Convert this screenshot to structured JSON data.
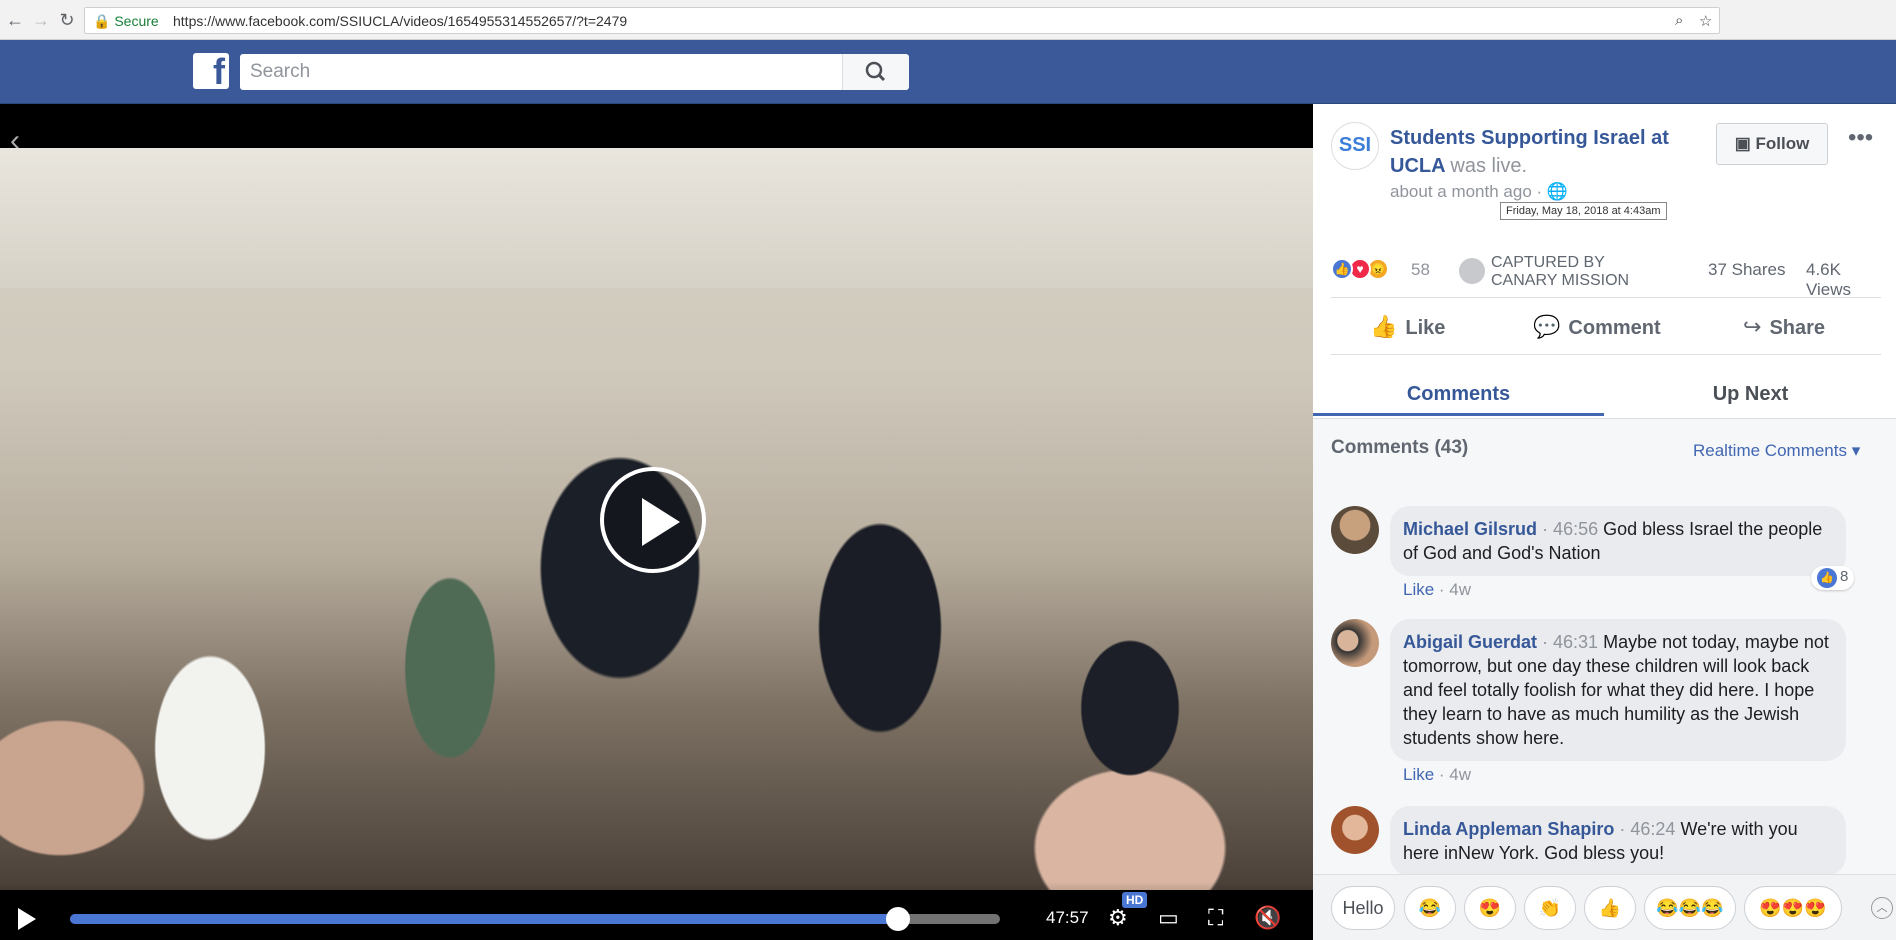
{
  "browser": {
    "secure_label": "Secure",
    "url": "https://www.facebook.com/SSIUCLA/videos/1654955314552657/?t=2479"
  },
  "header": {
    "logo": "f",
    "search_placeholder": "Search"
  },
  "video": {
    "time": "47:57",
    "hd_label": "HD",
    "progress_fraction": 0.89
  },
  "post": {
    "page_avatar_text": "SSI",
    "page_name": "Students Supporting Israel at UCLA",
    "was_live": "was live.",
    "time_ago": "about a month ago ·",
    "tooltip": "Friday, May 18, 2018 at 4:43am",
    "follow_label": "Follow",
    "more": "•••",
    "reaction_count": "58",
    "captured_line1": "CAPTURED BY",
    "captured_line2": "CANARY MISSION",
    "shares": "37 Shares",
    "views": "4.6K Views",
    "like_label": "Like",
    "comment_label": "Comment",
    "share_label": "Share"
  },
  "tabs": {
    "comments": "Comments",
    "up_next": "Up Next"
  },
  "comments_header": {
    "count": "Comments (43)",
    "filter": "Realtime Comments ▾"
  },
  "comments": [
    {
      "name": "Michael Gilsrud",
      "time": "· 46:56",
      "text": "God bless Israel the people of God and God's Nation",
      "like": "Like",
      "ago": "· 4w",
      "reactions": "8"
    },
    {
      "name": "Abigail Guerdat",
      "time": "· 46:31",
      "text": "Maybe not today, maybe not tomorrow, but one day these children will look back and feel totally foolish for what they did here. I hope they learn to have as much humility as the Jewish students show here.",
      "like": "Like",
      "ago": "· 4w"
    },
    {
      "name": "Linda Appleman Shapiro",
      "time": "· 46:24",
      "text": "We're with you here inNew York. God bless you!"
    }
  ],
  "quick_replies": [
    "Hello",
    "😂",
    "😍",
    "👏",
    "👍",
    "😂😂😂",
    "😍😍😍"
  ],
  "colors": {
    "facebook_blue": "#3b5998",
    "link_blue": "#365899",
    "progress_blue": "#4a76d4"
  }
}
